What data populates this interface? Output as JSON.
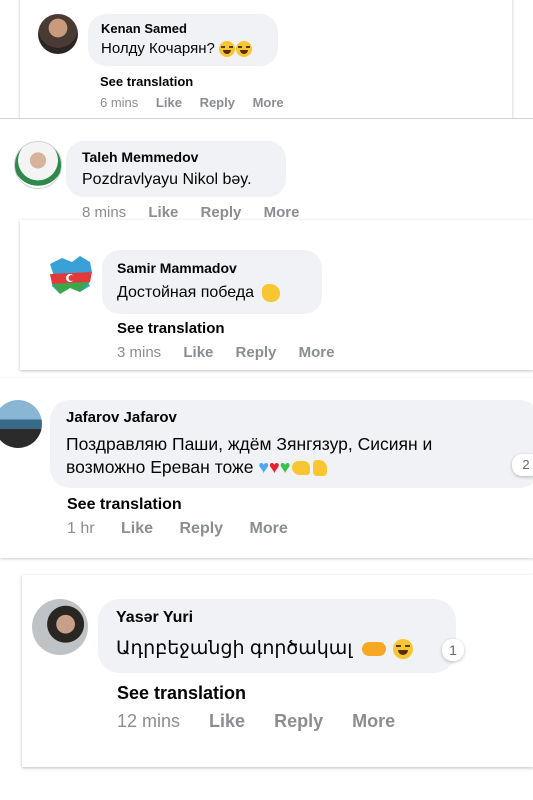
{
  "comments": [
    {
      "author": "Kenan Samed",
      "text": "Нолду Кочарян?",
      "emojis": [
        "face-with-tears-of-joy",
        "face-with-tears-of-joy"
      ],
      "see_translation": "See translation",
      "time": "6 mins",
      "like": "Like",
      "reply": "Reply",
      "more": "More"
    },
    {
      "author": "Taleh Memmedov",
      "text": "Pozdravlyayu Nikol bəy.",
      "time": "8 mins",
      "like": "Like",
      "reply": "Reply",
      "more": "More"
    },
    {
      "author": "Samir Mammadov",
      "text": "Достойная победа",
      "emojis": [
        "clapping-hands"
      ],
      "see_translation": "See translation",
      "time": "3 mins",
      "like": "Like",
      "reply": "Reply",
      "more": "More"
    },
    {
      "author": "Jafarov Jafarov",
      "text_line1": "Поздравляю Паши, ждём Зянгязур, Сисиян и",
      "text_line2": "возможно Ереван тоже",
      "emojis": [
        "blue-heart",
        "red-heart",
        "green-heart",
        "flexed-biceps",
        "thumbs-up"
      ],
      "reaction_count": "2",
      "see_translation": "See translation",
      "time": "1 hr",
      "like": "Like",
      "reply": "Reply",
      "more": "More"
    },
    {
      "author": "Yasər Yuri",
      "text": "Ադրբեջանցի գործակալ",
      "emojis": [
        "handshake",
        "face-with-tears-of-joy"
      ],
      "reaction_count": "1",
      "see_translation": "See translation",
      "time": "12 mins",
      "like": "Like",
      "reply": "Reply",
      "more": "More"
    }
  ],
  "colors": {
    "bubble": "#f0f2f5",
    "meta": "#8a8d91",
    "text": "#050505",
    "heart_blue": "#4ea7f0",
    "heart_red": "#e8202f",
    "heart_green": "#3cc04a",
    "emoji_yellow": "#f7c631"
  }
}
